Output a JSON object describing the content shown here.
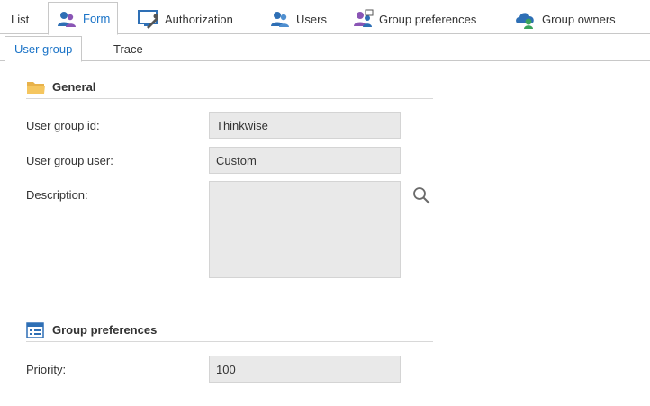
{
  "top_tabs": [
    {
      "label": "List",
      "icon": ""
    },
    {
      "label": "Form",
      "icon": "users-form-icon"
    },
    {
      "label": "Authorization",
      "icon": "authorization-icon"
    },
    {
      "label": "Users",
      "icon": "users-icon"
    },
    {
      "label": "Group preferences",
      "icon": "group-preferences-icon"
    },
    {
      "label": "Group owners",
      "icon": "group-owners-icon"
    }
  ],
  "active_top_tab": "Form",
  "sub_tabs": [
    {
      "label": "User group"
    },
    {
      "label": "Trace"
    }
  ],
  "active_sub_tab": "User group",
  "sections": {
    "general": {
      "title": "General",
      "icon": "folder-icon",
      "fields": {
        "user_group_id": {
          "label": "User group id:",
          "value": "Thinkwise"
        },
        "user_group_user": {
          "label": "User group user:",
          "value": "Custom"
        },
        "description": {
          "label": "Description:",
          "value": ""
        }
      }
    },
    "group_preferences": {
      "title": "Group preferences",
      "icon": "list-window-icon",
      "fields": {
        "priority": {
          "label": "Priority:",
          "value": "100"
        }
      }
    }
  },
  "colors": {
    "accent": "#1a73c7",
    "field_bg": "#e9e9e9",
    "border": "#c8c8c8"
  }
}
